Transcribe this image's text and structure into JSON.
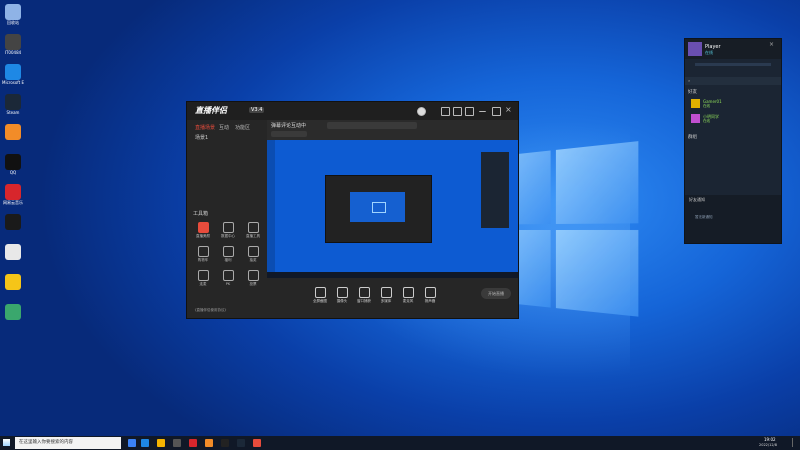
{
  "desktop": {
    "icons": [
      {
        "name": "recycle-bin-icon",
        "label": "回收站",
        "color": "#8fb3e6"
      },
      {
        "name": "app-icon-1",
        "label": "IT00484",
        "color": "#444"
      },
      {
        "name": "app-icon-2",
        "label": "Microsoft Edge",
        "color": "#1e88e5"
      },
      {
        "name": "steam-icon",
        "label": "Steam",
        "color": "#1b2838"
      },
      {
        "name": "app-icon-3",
        "label": "",
        "color": "#f28c28"
      },
      {
        "name": "qq-icon",
        "label": "QQ",
        "color": "#111"
      },
      {
        "name": "netease-music-icon",
        "label": "网易云音乐",
        "color": "#d7262c"
      },
      {
        "name": "app-icon-4",
        "label": "",
        "color": "#1a1a1a"
      },
      {
        "name": "file-icon",
        "label": "",
        "color": "#e8e8e8"
      },
      {
        "name": "app-icon-5",
        "label": "",
        "color": "#f5c518"
      },
      {
        "name": "app-icon-6",
        "label": "",
        "color": "#3aa76d"
      }
    ]
  },
  "app": {
    "brand": "直播伴侣",
    "version": "V3.4",
    "left_tabs": [
      "直播场景",
      "互动",
      "功能区"
    ],
    "scene_label": "场景1",
    "title_text": "弹幕评论互动中",
    "tools_title": "工具箱",
    "tools": [
      {
        "name": "tool-1",
        "label": "直播美颜",
        "color": "#e74c3c"
      },
      {
        "name": "tool-2",
        "label": "数据中心",
        "color": "#888"
      },
      {
        "name": "tool-3",
        "label": "直播工具",
        "color": "#888"
      },
      {
        "name": "tool-4",
        "label": "购物车",
        "color": "#888"
      },
      {
        "name": "tool-5",
        "label": "福利",
        "color": "#888"
      },
      {
        "name": "tool-6",
        "label": "抽奖",
        "color": "#888"
      },
      {
        "name": "tool-7",
        "label": "连麦",
        "color": "#888"
      },
      {
        "name": "tool-8",
        "label": "PK",
        "color": "#888"
      },
      {
        "name": "tool-9",
        "label": "投票",
        "color": "#888"
      }
    ],
    "bottom_tools": [
      {
        "name": "screen-capture",
        "label": "全屏截图"
      },
      {
        "name": "camera",
        "label": "摄像头"
      },
      {
        "name": "window-capture",
        "label": "窗口捕获"
      },
      {
        "name": "media",
        "label": "多媒体"
      },
      {
        "name": "microphone",
        "label": "麦克风"
      },
      {
        "name": "speaker",
        "label": "扬声器"
      }
    ],
    "start_button": "开始直播",
    "footer_text": "《直播伴侣使用协议》"
  },
  "steam": {
    "username": "Player",
    "status": "在线",
    "section_friends": "好友",
    "friends": [
      {
        "name": "Gamer01",
        "status": "在线",
        "color": "#e0b100"
      },
      {
        "name": "小明同学",
        "status": "在线",
        "color": "#c04fd0"
      }
    ],
    "section_groups": "群组",
    "notice_title": "好友通知",
    "notice_text": "暂无新通知"
  },
  "taskbar": {
    "search_placeholder": "在这里输入你要搜索的内容",
    "time": "19:02",
    "date": "2022/12/8"
  },
  "colors": {
    "accent": "#e74c3c",
    "steam_bg": "#1b2533"
  }
}
